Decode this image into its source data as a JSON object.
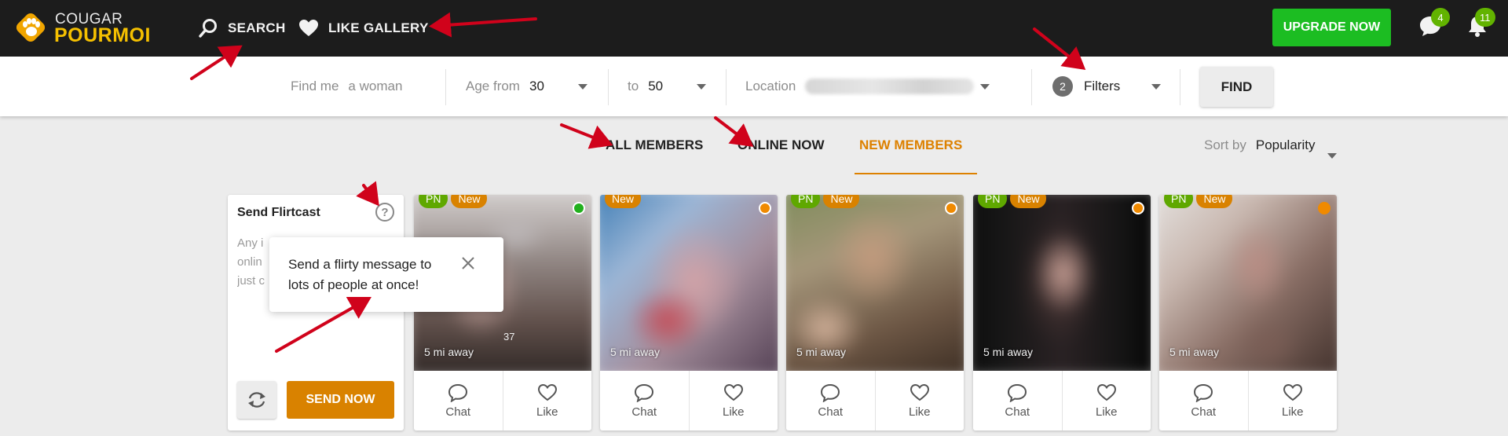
{
  "brand": {
    "line1": "COUGAR",
    "line2": "POURMOI"
  },
  "nav": {
    "search": "SEARCH",
    "like_gallery": "LIKE GALLERY"
  },
  "header": {
    "upgrade": "UPGRADE NOW",
    "messages_count": "4",
    "notifications_count": "11"
  },
  "filters": {
    "find_me_label": "Find me",
    "find_me_value": "a woman",
    "age_from_label": "Age from",
    "age_from_value": "30",
    "age_to_label": "to",
    "age_to_value": "50",
    "location_label": "Location",
    "filters_count": "2",
    "filters_label": "Filters",
    "find_button": "FIND"
  },
  "tabs": [
    {
      "label": "ALL MEMBERS"
    },
    {
      "label": "ONLINE NOW"
    },
    {
      "label": "NEW MEMBERS",
      "active": true
    }
  ],
  "sort": {
    "label": "Sort by",
    "value": "Popularity"
  },
  "flirtcast": {
    "title": "Send Flirtcast",
    "help": "?",
    "placeholder_lines": [
      "Any i",
      "onlin",
      "just c"
    ],
    "send_button": "SEND NOW",
    "tooltip": "Send a flirty message to lots of people at once!"
  },
  "members": [
    {
      "tags": [
        "PN",
        "New"
      ],
      "status": "online",
      "status_color": "#22b01e",
      "distance": "5 mi away",
      "photo_number": "37",
      "chat": "Chat",
      "like": "Like"
    },
    {
      "tags": [
        "New"
      ],
      "status": "away",
      "status_color": "#f08a00",
      "distance": "5 mi away",
      "chat": "Chat",
      "like": "Like"
    },
    {
      "tags": [
        "PN",
        "New"
      ],
      "status": "away",
      "status_color": "#f08a00",
      "distance": "5 mi away",
      "chat": "Chat",
      "like": "Like"
    },
    {
      "tags": [
        "PN",
        "New"
      ],
      "status": "away",
      "status_color": "#f08a00",
      "distance": "5 mi away",
      "chat": "Chat",
      "like": "Like"
    },
    {
      "tags": [
        "PN",
        "New"
      ],
      "status": "away",
      "status_color": "#f08a00",
      "distance": "5 mi away",
      "chat": "Chat",
      "like": "Like"
    }
  ],
  "colors": {
    "accent": "#d98200",
    "upgrade": "#1cbd22",
    "badge": "#5fa800",
    "topbar": "#1c1c1c",
    "annotation": "#d0021b"
  },
  "icons": [
    "paw-logo-icon",
    "search-icon",
    "heart-icon",
    "chat-bubble-icon",
    "bell-icon",
    "caret-down-icon",
    "help-icon",
    "close-icon",
    "refresh-icon"
  ]
}
